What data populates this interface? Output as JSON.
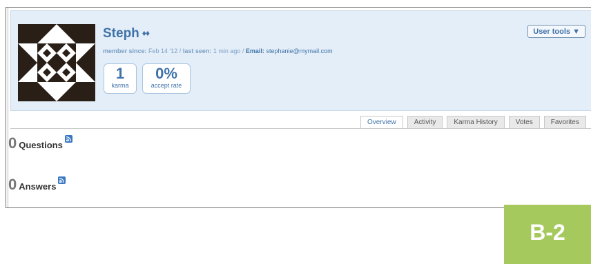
{
  "profile": {
    "name": "Steph",
    "diamonds": "♦♦",
    "member_since_label": "member since:",
    "member_since": "Feb 14 '12",
    "last_seen_label": "last seen:",
    "last_seen": "1 min ago",
    "email_label": "Email:",
    "email": "stephanie@mymail.com",
    "stats": [
      {
        "value": "1",
        "label": "karma"
      },
      {
        "value": "0%",
        "label": "accept rate"
      }
    ],
    "user_tools_label": "User tools ▼"
  },
  "tabs": [
    "Overview",
    "Activity",
    "Karma History",
    "Votes",
    "Favorites"
  ],
  "active_tab": "Overview",
  "sections": [
    {
      "count": "0",
      "title": "Questions",
      "icon": "rss-feed-icon"
    },
    {
      "count": "0",
      "title": "Answers",
      "icon": "rss-feed-icon"
    }
  ],
  "badge": {
    "label": "B-2",
    "color": "#a6c95d"
  },
  "colors": {
    "accent": "#3f72a8",
    "header_bg": "#e4eef8"
  }
}
